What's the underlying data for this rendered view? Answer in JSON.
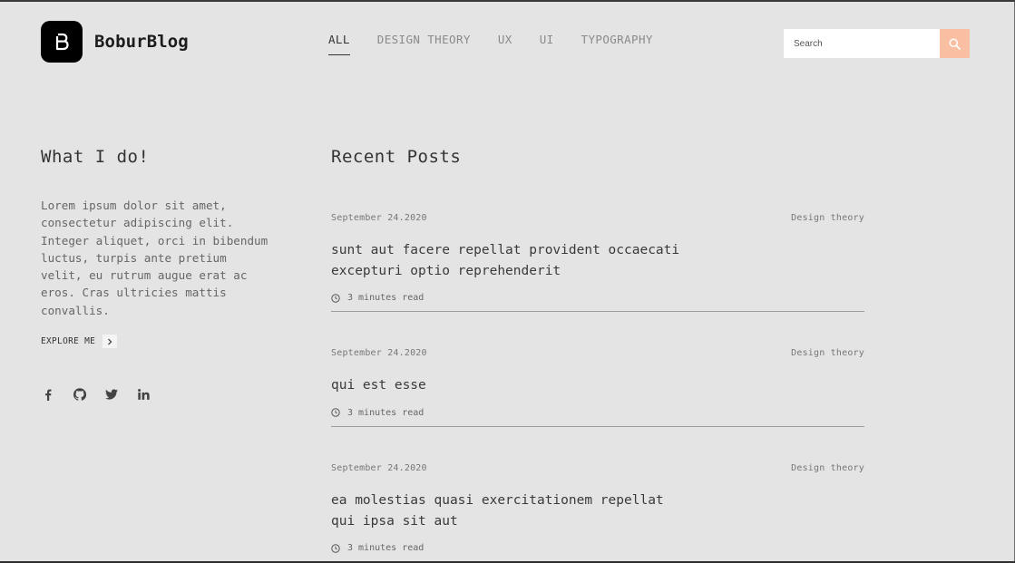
{
  "header": {
    "brand": "BoburBlog",
    "nav": [
      {
        "label": "ALL",
        "active": true
      },
      {
        "label": "DESIGN THEORY",
        "active": false
      },
      {
        "label": "UX",
        "active": false
      },
      {
        "label": "UI",
        "active": false
      },
      {
        "label": "TYPOGRAPHY",
        "active": false
      }
    ],
    "search": {
      "placeholder": "Search",
      "value": ""
    }
  },
  "about": {
    "title": "What I do!",
    "text": "Lorem ipsum dolor sit amet,\nconsectetur adipiscing elit.\nInteger aliquet, orci in bibendum\nluctus, turpis ante pretium\nvelit, eu rutrum augue erat ac\neros. Cras ultricies mattis\nconvallis.",
    "explore_label": "EXPLORE ME",
    "socials": [
      "facebook-icon",
      "github-icon",
      "twitter-icon",
      "linkedin-icon"
    ]
  },
  "posts": {
    "title": "Recent Posts",
    "items": [
      {
        "date": "September 24.2020",
        "category": "Design theory",
        "title": "sunt aut facere repellat provident occaecati\nexcepturi optio reprehenderit",
        "read_time": "3 minutes read"
      },
      {
        "date": "September 24.2020",
        "category": "Design theory",
        "title": "qui est esse",
        "read_time": "3 minutes read"
      },
      {
        "date": "September 24.2020",
        "category": "Design theory",
        "title": "ea molestias quasi exercitationem repellat\nqui ipsa sit aut",
        "read_time": "3 minutes read"
      }
    ]
  },
  "colors": {
    "background": "#e4e4e4",
    "accent": "#f8bfa2",
    "logo": "#000000"
  }
}
